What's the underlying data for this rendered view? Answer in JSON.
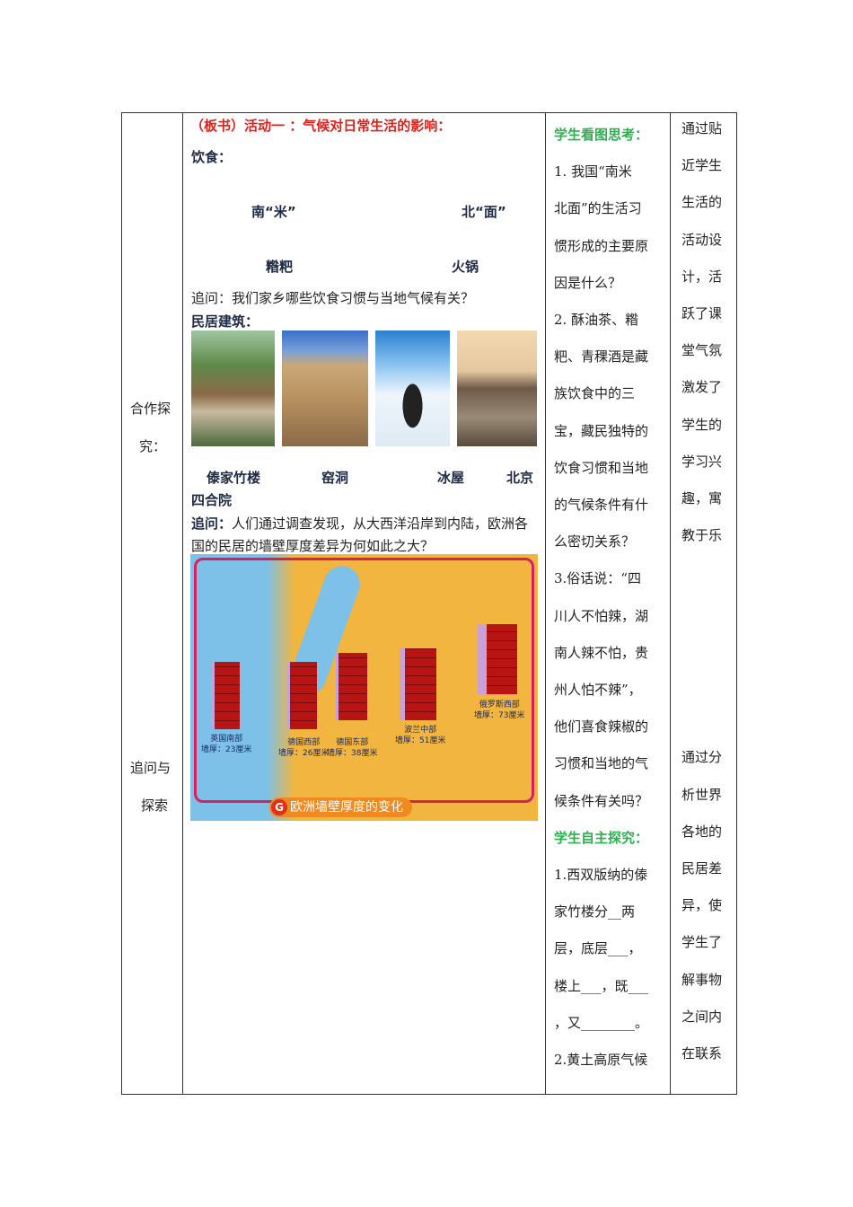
{
  "col1": {
    "label1": [
      "合作探",
      "究："
    ],
    "label2": [
      "追问与",
      "探索"
    ]
  },
  "col2": {
    "heading": "（板书）活动一 ：气候对日常生活的影响：",
    "food_label": "饮食：",
    "food_items": [
      "南“米”",
      "北“面”",
      "糌粑",
      "火锅"
    ],
    "question1": "追问：我们家乡哪些饮食习惯与当地气候有关？",
    "housing_label": "民居建筑：",
    "photo_captions": [
      "傣家竹楼",
      "窑洞",
      "冰屋",
      "北京"
    ],
    "caption_wrap": "四合院",
    "question2_label": "追问：",
    "question2": "人们通过调查发现，从大西洋沿岸到内陆，欧洲各国的民居的墙壁厚度差异为何如此之大？",
    "map": {
      "title": "欧洲墙壁厚度的变化",
      "badge": "G",
      "walls": [
        {
          "region": "英国南部",
          "thickness": "墙厚：23厘米"
        },
        {
          "region": "德国西部",
          "thickness": "墙厚：26厘米"
        },
        {
          "region": "德国东部",
          "thickness": "墙厚：38厘米"
        },
        {
          "region": "波兰中部",
          "thickness": "墙厚：51厘米"
        },
        {
          "region": "俄罗斯西部",
          "thickness": "墙厚：73厘米"
        }
      ]
    }
  },
  "col3": {
    "heading1": "学生看图思考：",
    "lines1": [
      "1. 我国“南米",
      "北面”的生活习",
      "惯形成的主要原",
      "因是什么？",
      "2. 酥油茶、糌",
      "粑、青稞酒是藏",
      "族饮食中的三",
      "宝，藏民独特的",
      "饮食习惯和当地",
      "的气候条件有什",
      "么密切关系？",
      "3.俗话说：“四",
      "川人不怕辣，湖",
      "南人辣不怕，贵",
      "州人怕不辣”，",
      "他们喜食辣椒的",
      "习惯和当地的气",
      "候条件有关吗？"
    ],
    "heading2": "学生自主探究：",
    "lines2": [
      "1.西双版纳的傣",
      "家竹楼分__两",
      "层，底层___，",
      "楼上___，既___",
      "，又________。",
      "2.黄土高原气候"
    ]
  },
  "col4": {
    "lines1": [
      "通过贴",
      "近学生",
      "生活的",
      "活动设",
      "计，活",
      "跃了课",
      "堂气氛",
      "激发了",
      "学生的",
      "学习兴",
      "趣，寓",
      "教于乐"
    ],
    "lines2": [
      "通过分",
      "析世界",
      "各地的",
      "民居差",
      "异，使",
      "学生了",
      "解事物",
      "之间内",
      "在联系"
    ]
  }
}
